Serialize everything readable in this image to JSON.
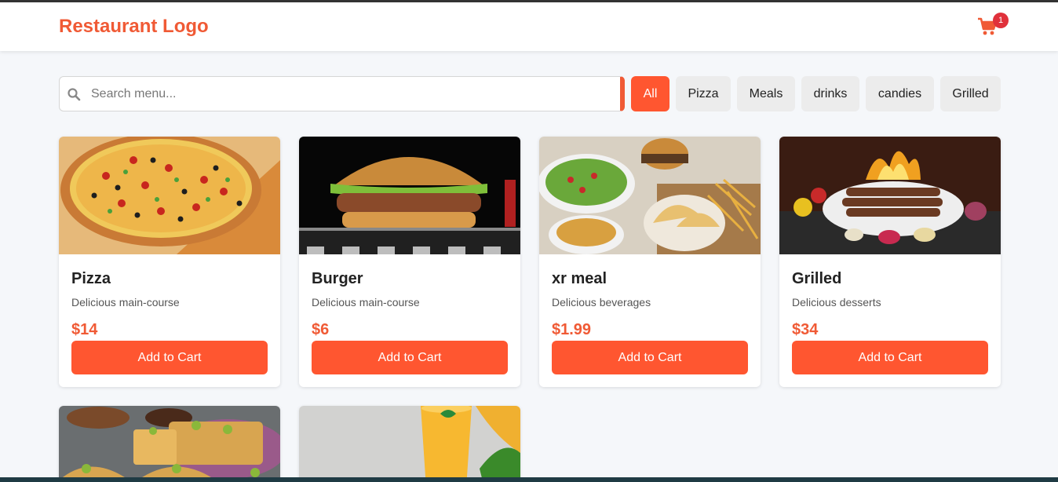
{
  "header": {
    "logo": "Restaurant Logo",
    "cart_count": "1"
  },
  "search": {
    "placeholder": "Search menu..."
  },
  "filters": [
    "All",
    "Pizza",
    "Meals",
    "drinks",
    "candies",
    "Grilled"
  ],
  "active_filter": "All",
  "colors": {
    "accent": "#ff5630",
    "logo": "#f05a35",
    "badge": "#e0313b"
  },
  "menu": [
    {
      "name": "Pizza",
      "desc": "Delicious main-course",
      "price": "$14",
      "button": "Add to Cart",
      "image": "pizza-image"
    },
    {
      "name": "Burger",
      "desc": "Delicious main-course",
      "price": "$6",
      "button": "Add to Cart",
      "image": "burger-image"
    },
    {
      "name": "xr meal",
      "desc": "Delicious beverages",
      "price": "$1.99",
      "button": "Add to Cart",
      "image": "meal-platter-image"
    },
    {
      "name": "Grilled",
      "desc": "Delicious desserts",
      "price": "$34",
      "button": "Add to Cart",
      "image": "grilled-meat-image"
    }
  ],
  "partial_cards": [
    {
      "image": "baklava-image"
    },
    {
      "image": "mango-juice-image"
    }
  ]
}
